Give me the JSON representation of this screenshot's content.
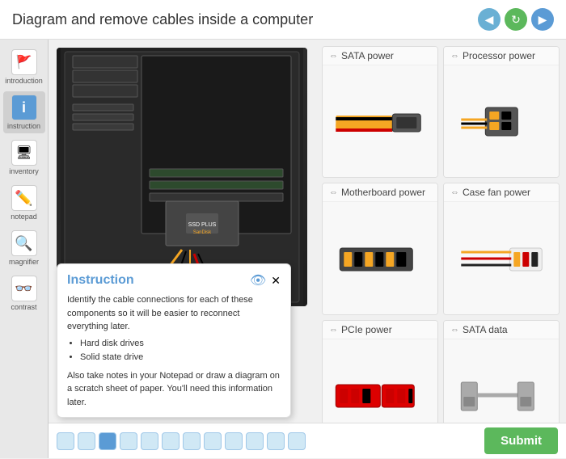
{
  "header": {
    "title": "Diagram and remove cables inside a computer",
    "nav": {
      "prev_label": "◀",
      "refresh_label": "↻",
      "next_label": "▶"
    }
  },
  "sidebar": {
    "items": [
      {
        "id": "introduction",
        "label": "introduction",
        "icon": "🚩"
      },
      {
        "id": "instruction",
        "label": "instruction",
        "icon": "ℹ"
      },
      {
        "id": "inventory",
        "label": "inventory",
        "icon": "🖥"
      },
      {
        "id": "notepad",
        "label": "notepad",
        "icon": "✏"
      },
      {
        "id": "magnifier",
        "label": "magnifier",
        "icon": "🔍"
      },
      {
        "id": "contrast",
        "label": "contrast",
        "icon": "👓"
      }
    ]
  },
  "cables": [
    {
      "id": "sata-power",
      "label": "SATA power",
      "color_a": "#f5a623",
      "color_b": "#000",
      "color_c": "#f5a623"
    },
    {
      "id": "processor-power",
      "label": "Processor power",
      "color_a": "#f5a623",
      "color_b": "#000",
      "color_c": "#666"
    },
    {
      "id": "motherboard-power",
      "label": "Motherboard power",
      "color_a": "#888",
      "color_b": "#f5a623",
      "color_c": "#000"
    },
    {
      "id": "case-fan-power",
      "label": "Case fan power",
      "color_a": "#f5a623",
      "color_b": "#fff",
      "color_c": "#888"
    },
    {
      "id": "pcie-power",
      "label": "PCIe power",
      "color_a": "#e00",
      "color_b": "#e00",
      "color_c": "#000"
    },
    {
      "id": "sata-data",
      "label": "SATA data",
      "color_a": "#aaa",
      "color_b": "#aaa",
      "color_c": "#888"
    }
  ],
  "instruction": {
    "title": "Instruction",
    "body": "Identify the cable connections for each of these components so it will be easier to reconnect everything later.",
    "list": [
      "Hard disk drives",
      "Solid state drive"
    ],
    "footer": "Also take notes in your Notepad or draw a diagram on a scratch sheet of paper. You'll need this information later."
  },
  "bottom": {
    "submit_label": "Submit"
  }
}
